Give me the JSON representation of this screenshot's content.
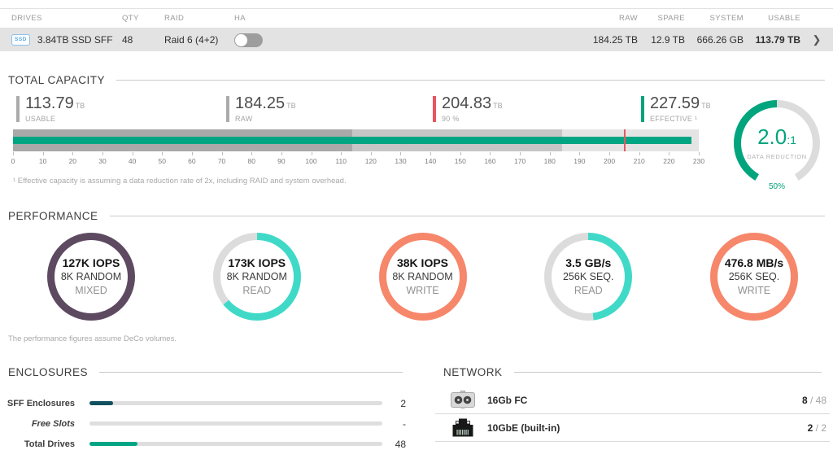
{
  "drives_table": {
    "headers": {
      "drives": "DRIVES",
      "qty": "QTY",
      "raid": "RAID",
      "ha": "HA",
      "raw": "RAW",
      "spare": "SPARE",
      "system": "SYSTEM",
      "usable": "USABLE"
    },
    "row": {
      "badge": "SSD",
      "drive": "3.84TB SSD SFF",
      "qty": "48",
      "raid": "Raid 6 (4+2)",
      "ha_on": false,
      "raw": "184.25 TB",
      "spare": "12.9 TB",
      "system": "666.26 GB",
      "usable": "113.79 TB",
      "expand": "❯"
    }
  },
  "total_capacity": {
    "title": "TOTAL CAPACITY",
    "markers": [
      {
        "value": "113.79",
        "unit": "TB",
        "label": "USABLE",
        "color": "#ababab"
      },
      {
        "value": "184.25",
        "unit": "TB",
        "label": "RAW",
        "color": "#ababab"
      },
      {
        "value": "204.83",
        "unit": "TB",
        "label": "90 %",
        "color": "#e85560"
      },
      {
        "value": "227.59",
        "unit": "TB",
        "label": "EFFECTIVE ¹",
        "color": "#00a47d"
      }
    ],
    "bar": {
      "axis_max": 230,
      "usable_tb": 113.79,
      "raw_tb": 184.25,
      "threshold_90_tb": 204.83,
      "effective_tb": 227.59,
      "ticks": [
        0,
        10,
        20,
        30,
        40,
        50,
        60,
        70,
        80,
        90,
        100,
        110,
        120,
        130,
        140,
        150,
        160,
        170,
        180,
        190,
        200,
        210,
        220,
        230
      ],
      "colors": {
        "background": "#e4e4e4",
        "raw": "#c6c6c6",
        "usable": "#a9a9a9",
        "effective": "#00a583",
        "threshold": "#e25a62"
      }
    },
    "gauge": {
      "value": "2.0",
      "suffix": ":1",
      "label": "DATA REDUCTION",
      "percent_label": "50%",
      "arc_color": "#00a47d",
      "track_color": "#dcdcdc"
    },
    "footnote": "¹ Effective capacity is assuming a data reduction rate of 2x, including RAID and system overhead."
  },
  "performance": {
    "title": "PERFORMANCE",
    "donuts": [
      {
        "value": "127K IOPS",
        "line2": "8K RANDOM",
        "line3": "MIXED",
        "color": "#5d4a61",
        "arc_percent": 100
      },
      {
        "value": "173K IOPS",
        "line2": "8K RANDOM",
        "line3": "READ",
        "color": "#40d9c8",
        "arc_percent": 64
      },
      {
        "value": "38K IOPS",
        "line2": "8K RANDOM",
        "line3": "WRITE",
        "color": "#f6876b",
        "arc_percent": 100
      },
      {
        "value": "3.5 GB/s",
        "line2": "256K SEQ.",
        "line3": "READ",
        "color": "#40d9c8",
        "arc_percent": 48
      },
      {
        "value": "476.8 MB/s",
        "line2": "256K SEQ.",
        "line3": "WRITE",
        "color": "#f6876b",
        "arc_percent": 100
      }
    ],
    "note": "The performance figures assume DeCo volumes."
  },
  "enclosures": {
    "title": "ENCLOSURES",
    "rows": [
      {
        "label": "SFF Enclosures",
        "value": "2",
        "fill_percent": 8,
        "color": "#10505f",
        "italic": false
      },
      {
        "label": "Free Slots",
        "value": "-",
        "fill_percent": 0,
        "color": "#dedede",
        "italic": true
      },
      {
        "label": "Total Drives",
        "value": "48",
        "fill_percent": 16.5,
        "color": "#00a583",
        "italic": false
      }
    ]
  },
  "network": {
    "title": "NETWORK",
    "rows": [
      {
        "icon": "fc-port-icon",
        "label": "16Gb FC",
        "used": "8",
        "separator": " / ",
        "total": "48"
      },
      {
        "icon": "ethernet-port-icon",
        "label": "10GbE (built-in)",
        "used": "2",
        "separator": " / ",
        "total": "2"
      }
    ]
  }
}
